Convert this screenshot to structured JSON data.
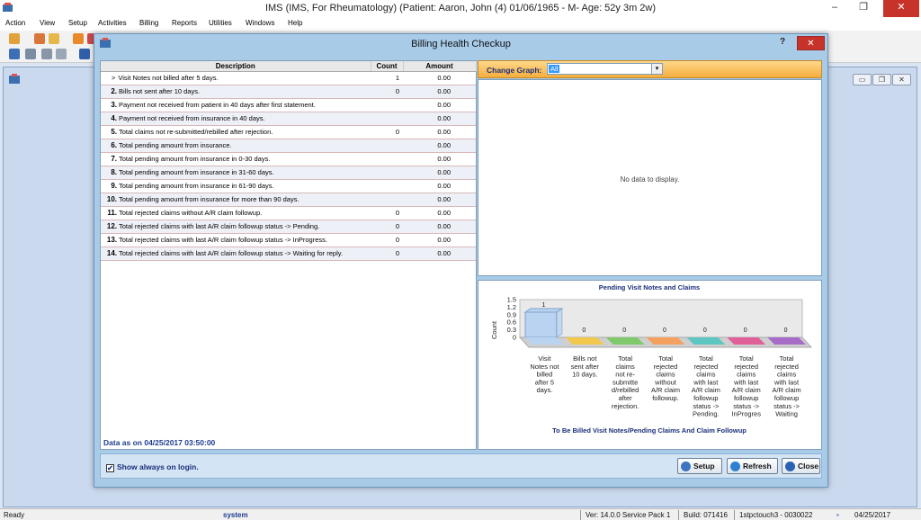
{
  "window": {
    "title": "IMS (IMS, For Rheumatology)    (Patient: Aaron, John  (4) 01/06/1965 - M- Age: 52y 3m 2w)",
    "minimize": "–",
    "maximize": "❐",
    "close": "✕"
  },
  "menu": [
    "Action",
    "View",
    "Setup",
    "Activities",
    "Billing",
    "Reports",
    "Utilities",
    "Windows",
    "Help"
  ],
  "dialog": {
    "title": "Billing Health Checkup",
    "help": "?",
    "close": "✕",
    "table": {
      "headers": [
        "Description",
        "Count",
        "Amount"
      ],
      "rows": [
        {
          "num": "",
          "prefix": ">",
          "desc": "Visit Notes not billed after 5 days.",
          "count": "1",
          "amount": "0.00"
        },
        {
          "num": "2.",
          "desc": "Bills not sent after 10 days.",
          "count": "0",
          "amount": "0.00"
        },
        {
          "num": "3.",
          "desc": "Payment not received from patient in 40 days after first statement.",
          "count": "",
          "amount": "0.00"
        },
        {
          "num": "4.",
          "desc": "Payment not received from insurance in 40 days.",
          "count": "",
          "amount": "0.00"
        },
        {
          "num": "5.",
          "desc": "Total claims not re-submitted/rebilled after rejection.",
          "count": "0",
          "amount": "0.00"
        },
        {
          "num": "6.",
          "desc": "Total pending amount from insurance.",
          "count": "",
          "amount": "0.00"
        },
        {
          "num": "7.",
          "desc": "Total pending amount from insurance in 0-30 days.",
          "count": "",
          "amount": "0.00"
        },
        {
          "num": "8.",
          "desc": "Total pending amount from insurance in 31-60 days.",
          "count": "",
          "amount": "0.00"
        },
        {
          "num": "9.",
          "desc": "Total pending amount from insurance in 61-90 days.",
          "count": "",
          "amount": "0.00"
        },
        {
          "num": "10.",
          "desc": "Total pending amount from insurance for more than 90 days.",
          "count": "",
          "amount": "0.00"
        },
        {
          "num": "11.",
          "desc": "Total rejected claims without A/R claim followup.",
          "count": "0",
          "amount": "0.00"
        },
        {
          "num": "12.",
          "desc": "Total rejected claims with last A/R claim followup status -> Pending.",
          "count": "0",
          "amount": "0.00"
        },
        {
          "num": "13.",
          "desc": "Total rejected claims with last A/R claim followup status -> InProgress.",
          "count": "0",
          "amount": "0.00"
        },
        {
          "num": "14.",
          "desc": "Total rejected claims with last A/R claim followup status -> Waiting for reply.",
          "count": "0",
          "amount": "0.00"
        }
      ]
    },
    "data_as_on": "Data as on 04/25/2017 03:50:00",
    "change_graph_label": "Change Graph:",
    "change_graph_value": "All",
    "no_data": "No data to display.",
    "show_always_label": "Show always on login.",
    "show_always_checked": "✔",
    "buttons": {
      "setup": "Setup",
      "refresh": "Refresh",
      "close": "Close"
    }
  },
  "chart_data": {
    "type": "bar",
    "title": "Pending Visit Notes and Claims",
    "xlabel": "To Be Billed Visit Notes/Pending Claims And Claim Followup",
    "ylabel": "Count",
    "ylim": [
      0,
      1.5
    ],
    "yticks": [
      "1.5",
      "1.2",
      "0.9",
      "0.6",
      "0.3",
      "0"
    ],
    "categories": [
      [
        "Visit",
        "Notes not",
        "billed",
        "after 5",
        "days."
      ],
      [
        "Bills not",
        "sent after",
        "10 days."
      ],
      [
        "Total",
        "claims",
        "not re-",
        "submitte",
        "d/rebilled",
        "after",
        "rejection."
      ],
      [
        "Total",
        "rejected",
        "claims",
        "without",
        "A/R claim",
        "followup."
      ],
      [
        "Total",
        "rejected",
        "claims",
        "with last",
        "A/R claim",
        "followup",
        "status ->",
        "Pending."
      ],
      [
        "Total",
        "rejected",
        "claims",
        "with last",
        "A/R claim",
        "followup",
        "status ->",
        "InProgres"
      ],
      [
        "Total",
        "rejected",
        "claims",
        "with last",
        "A/R claim",
        "followup",
        "status ->",
        "Waiting"
      ]
    ],
    "values": [
      1,
      0,
      0,
      0,
      0,
      0,
      0
    ],
    "value_labels": [
      "1",
      "0",
      "0",
      "0",
      "0",
      "0",
      "0"
    ],
    "colors": [
      "#b9d3f0",
      "#f2c94c",
      "#7fc96b",
      "#f4a15f",
      "#5ec6c0",
      "#e0609a",
      "#a66cc7"
    ]
  },
  "statusbar": {
    "ready": "Ready",
    "user": "system",
    "version": "Ver: 14.0.0 Service Pack 1",
    "build": "Build: 071416",
    "machine": "1stpctouch3 - 0030022",
    "date": "04/25/2017"
  }
}
